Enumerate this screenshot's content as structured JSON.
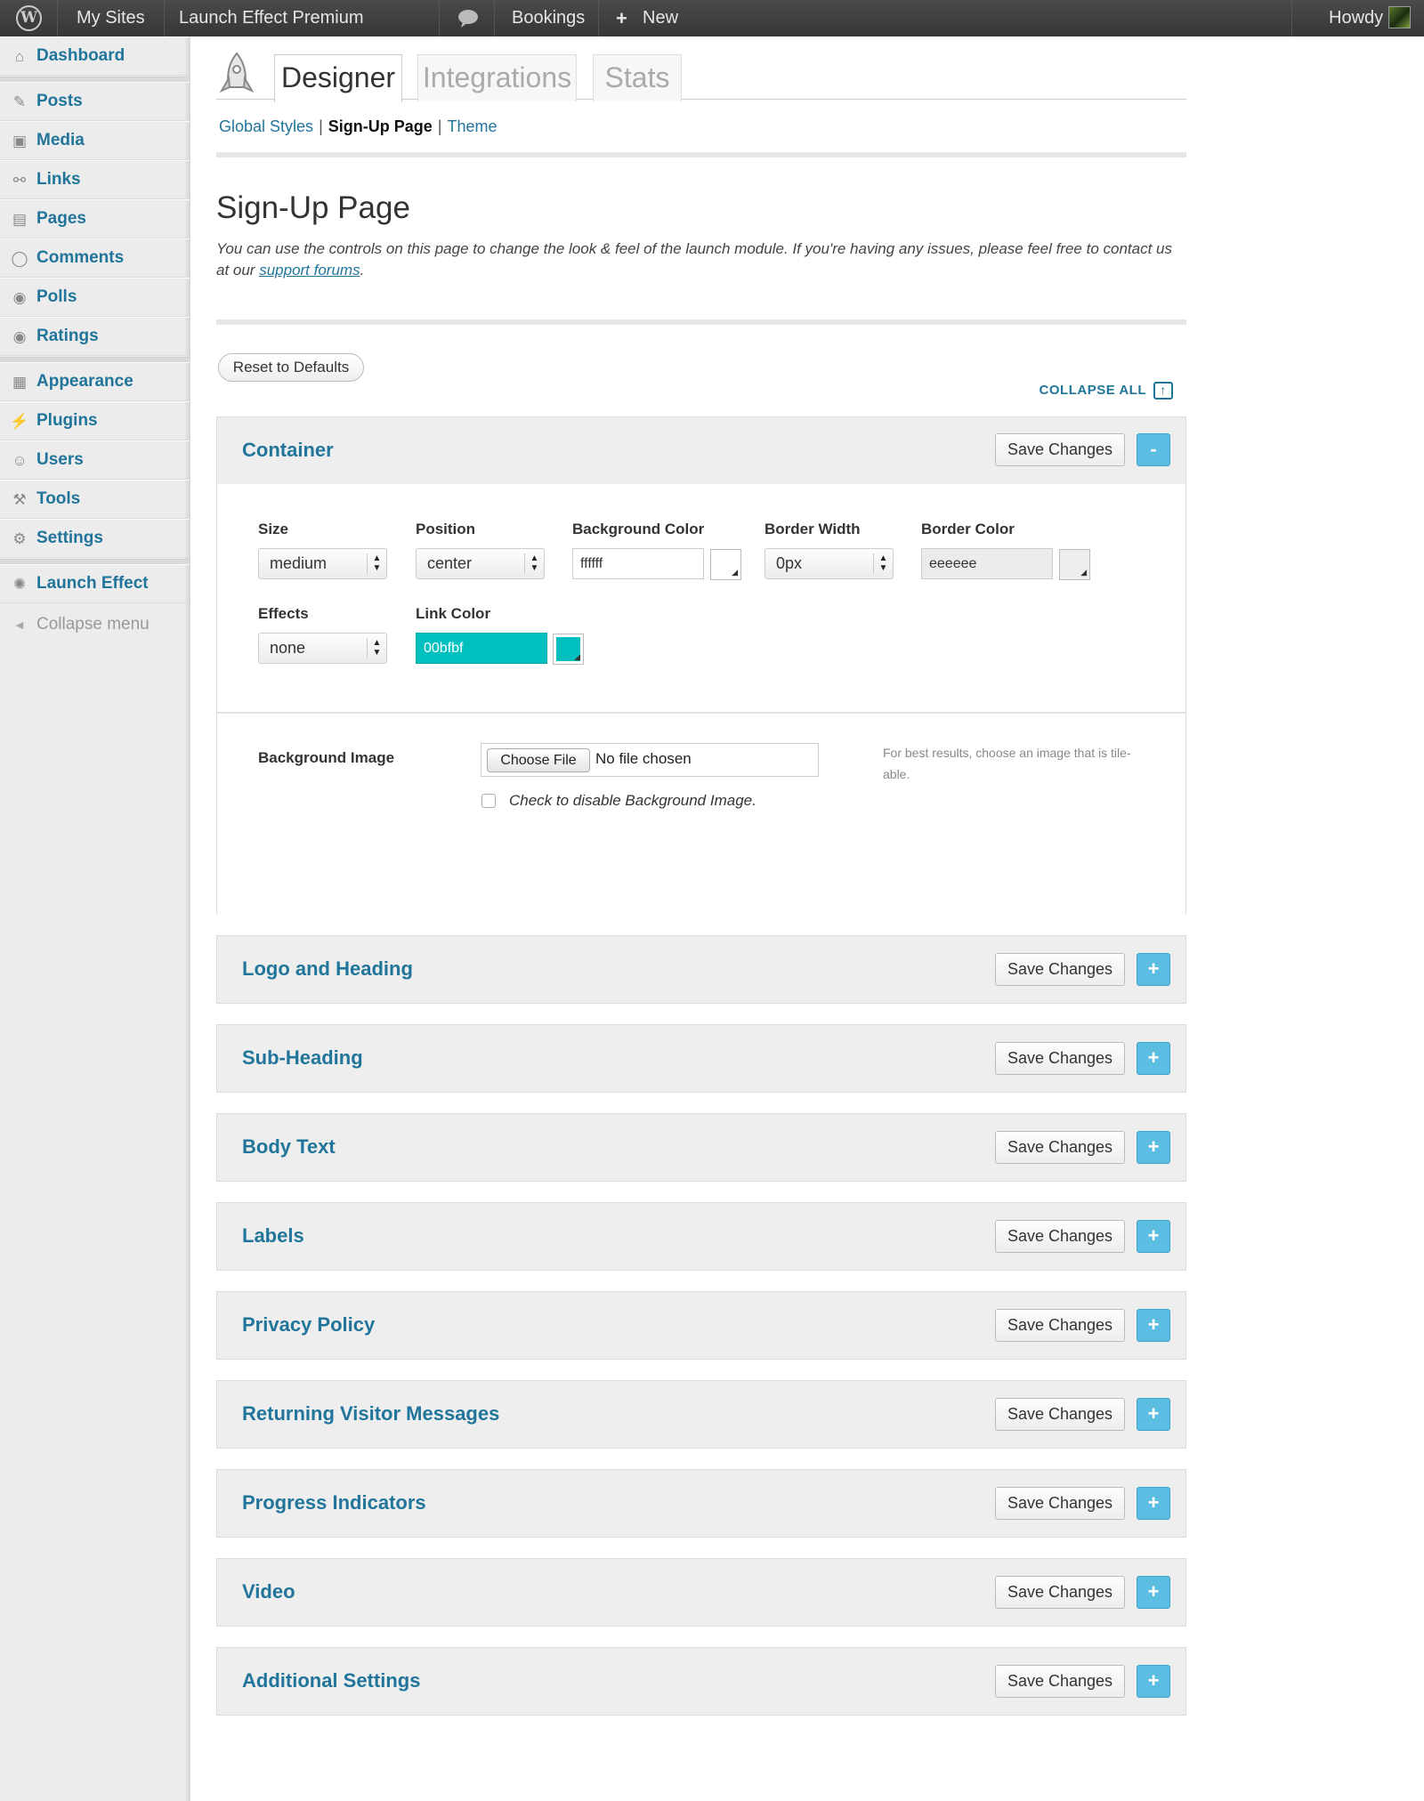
{
  "adminbar": {
    "wp_logo": "W",
    "my_sites": "My Sites",
    "site_name": "Launch Effect Premium",
    "bookings": "Bookings",
    "new": "New",
    "howdy": "Howdy",
    "comments_icon": "speech-bubble-icon",
    "plus_icon": "plus-icon"
  },
  "sidebar": {
    "items": [
      {
        "label": "Dashboard",
        "icon": "⌂"
      },
      {
        "label": "Posts",
        "icon": "✎"
      },
      {
        "label": "Media",
        "icon": "▣"
      },
      {
        "label": "Links",
        "icon": "⚯"
      },
      {
        "label": "Pages",
        "icon": "▤"
      },
      {
        "label": "Comments",
        "icon": "◯"
      },
      {
        "label": "Polls",
        "icon": "◉"
      },
      {
        "label": "Ratings",
        "icon": "◉"
      },
      {
        "label": "Appearance",
        "icon": "▦"
      },
      {
        "label": "Plugins",
        "icon": "⚡"
      },
      {
        "label": "Users",
        "icon": "☺"
      },
      {
        "label": "Tools",
        "icon": "⚒"
      },
      {
        "label": "Settings",
        "icon": "⚙"
      },
      {
        "label": "Launch Effect",
        "icon": "✺"
      },
      {
        "label": "Collapse menu",
        "icon": "◀"
      }
    ]
  },
  "tabs": [
    "Designer",
    "Integrations",
    "Stats"
  ],
  "subnav": {
    "global": "Global Styles",
    "signup": "Sign-Up Page",
    "theme": "Theme"
  },
  "page": {
    "title": "Sign-Up Page",
    "intro": "You can use the controls on this page to change the look & feel of the launch module. If you're having any issues, please feel free to contact us at our ",
    "intro_link": "support forums",
    "intro_end": ".",
    "reset": "Reset to Defaults",
    "collapse_all": "COLLAPSE ALL"
  },
  "container": {
    "title": "Container",
    "save": "Save Changes",
    "toggle": "-",
    "size_label": "Size",
    "size_value": "medium",
    "position_label": "Position",
    "position_value": "center",
    "bg_color_label": "Background Color",
    "bg_color_value": "ffffff",
    "border_width_label": "Border Width",
    "border_width_value": "0px",
    "border_color_label": "Border Color",
    "border_color_value": "eeeeee",
    "effects_label": "Effects",
    "effects_value": "none",
    "link_color_label": "Link Color",
    "link_color_value": "00bfbf",
    "link_color_hex": "#00bfbf",
    "bg_image_label": "Background Image",
    "choose_file": "Choose File",
    "no_file": "No file chosen",
    "disable_bg": "Check to disable Background Image.",
    "hint": "For best results, choose an image that is tile-able."
  },
  "panels": [
    {
      "title": "Logo and Heading",
      "save": "Save Changes",
      "toggle": "+"
    },
    {
      "title": "Sub-Heading",
      "save": "Save Changes",
      "toggle": "+"
    },
    {
      "title": "Body Text",
      "save": "Save Changes",
      "toggle": "+"
    },
    {
      "title": "Labels",
      "save": "Save Changes",
      "toggle": "+"
    },
    {
      "title": "Privacy Policy",
      "save": "Save Changes",
      "toggle": "+"
    },
    {
      "title": "Returning Visitor Messages",
      "save": "Save Changes",
      "toggle": "+"
    },
    {
      "title": "Progress Indicators",
      "save": "Save Changes",
      "toggle": "+"
    },
    {
      "title": "Video",
      "save": "Save Changes",
      "toggle": "+"
    },
    {
      "title": "Additional Settings",
      "save": "Save Changes",
      "toggle": "+"
    }
  ],
  "colors": {
    "accent": "#21759b",
    "toggle": "#5cbde2",
    "link_swatch": "#00bfbf"
  }
}
